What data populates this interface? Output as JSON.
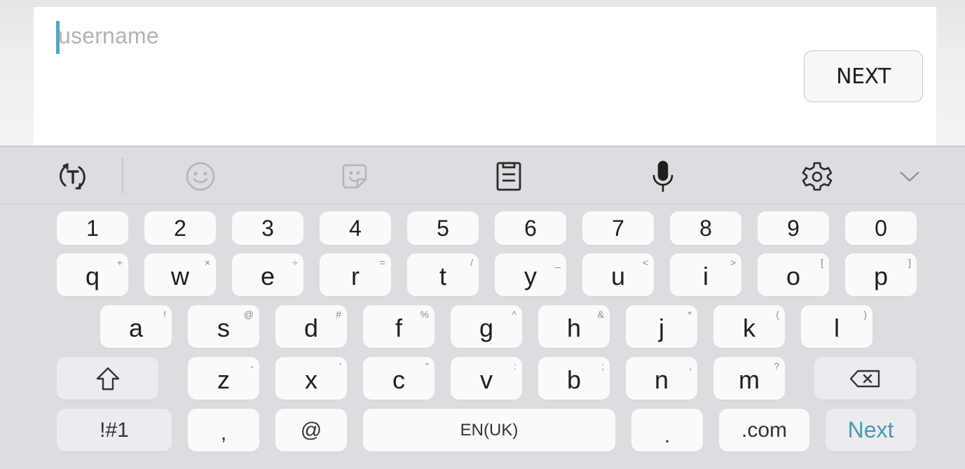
{
  "login": {
    "username_placeholder": "username",
    "username_value": "",
    "next_button_label": "NEXT"
  },
  "keyboard": {
    "toolbar": {
      "items": [
        {
          "name": "text-translate-icon"
        },
        {
          "name": "emoji-icon"
        },
        {
          "name": "sticker-icon"
        },
        {
          "name": "clipboard-icon"
        },
        {
          "name": "microphone-icon"
        },
        {
          "name": "settings-gear-icon"
        },
        {
          "name": "collapse-chevron-down-icon"
        }
      ]
    },
    "number_row": [
      "1",
      "2",
      "3",
      "4",
      "5",
      "6",
      "7",
      "8",
      "9",
      "0"
    ],
    "row1": [
      {
        "key": "q",
        "alt": "+"
      },
      {
        "key": "w",
        "alt": "×"
      },
      {
        "key": "e",
        "alt": "÷"
      },
      {
        "key": "r",
        "alt": "="
      },
      {
        "key": "t",
        "alt": "/"
      },
      {
        "key": "y",
        "alt": "_"
      },
      {
        "key": "u",
        "alt": "<"
      },
      {
        "key": "i",
        "alt": ">"
      },
      {
        "key": "o",
        "alt": "["
      },
      {
        "key": "p",
        "alt": "]"
      }
    ],
    "row2": [
      {
        "key": "a",
        "alt": "!"
      },
      {
        "key": "s",
        "alt": "@"
      },
      {
        "key": "d",
        "alt": "#"
      },
      {
        "key": "f",
        "alt": "%"
      },
      {
        "key": "g",
        "alt": "^"
      },
      {
        "key": "h",
        "alt": "&"
      },
      {
        "key": "j",
        "alt": "*"
      },
      {
        "key": "k",
        "alt": "("
      },
      {
        "key": "l",
        "alt": ")"
      }
    ],
    "row3": [
      {
        "key": "z",
        "alt": "-"
      },
      {
        "key": "x",
        "alt": "'"
      },
      {
        "key": "c",
        "alt": "\""
      },
      {
        "key": "v",
        "alt": ":"
      },
      {
        "key": "b",
        "alt": ";"
      },
      {
        "key": "n",
        "alt": ","
      },
      {
        "key": "m",
        "alt": "?"
      }
    ],
    "bottom_row": {
      "symbols": "!#1",
      "comma": ",",
      "at": "@",
      "space": "EN(UK)",
      "period": ".",
      "dotcom": ".com",
      "action": "Next"
    },
    "colors": {
      "accent": "#4a97b5",
      "caret": "#5aa3bf",
      "keyboard_bg": "#dcdde0",
      "key_bg": "#fafafa",
      "func_key_bg": "#ebecef"
    }
  }
}
